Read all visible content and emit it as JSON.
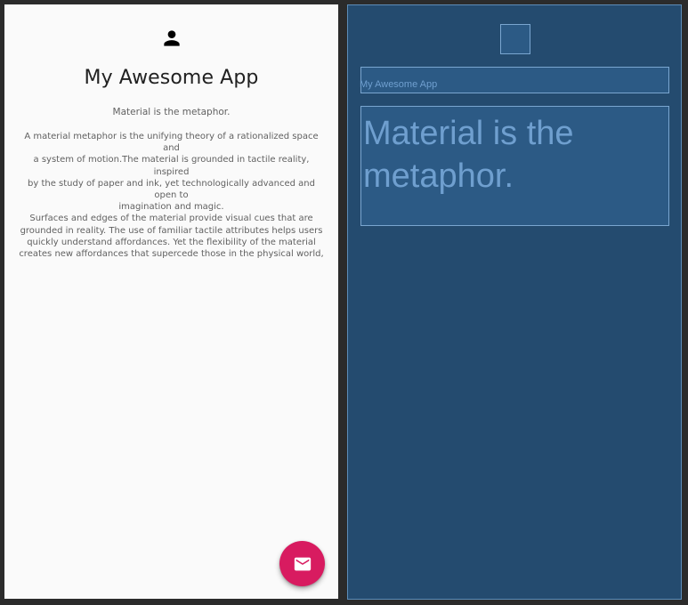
{
  "app": {
    "title": "My Awesome App",
    "subtitle": "Material is the metaphor.",
    "body": "A material metaphor is the unifying theory of a rationalized space and\na system of motion.The material is grounded in tactile reality, inspired\nby the study of paper and ink, yet technologically advanced and open to\nimagination and magic.\nSurfaces and edges of the material provide visual cues that are\ngrounded in reality. The use of familiar tactile attributes helps users\nquickly understand affordances. Yet the flexibility of the material\ncreates new affordances that supercede those in the physical world,",
    "avatar_icon": "person-icon",
    "fab_icon": "mail-icon",
    "fab_color": "#d81b60"
  },
  "blueprint": {
    "title_text": "My Awesome App",
    "body_text": "Material is the metaphor.",
    "background": "#244b6f"
  }
}
